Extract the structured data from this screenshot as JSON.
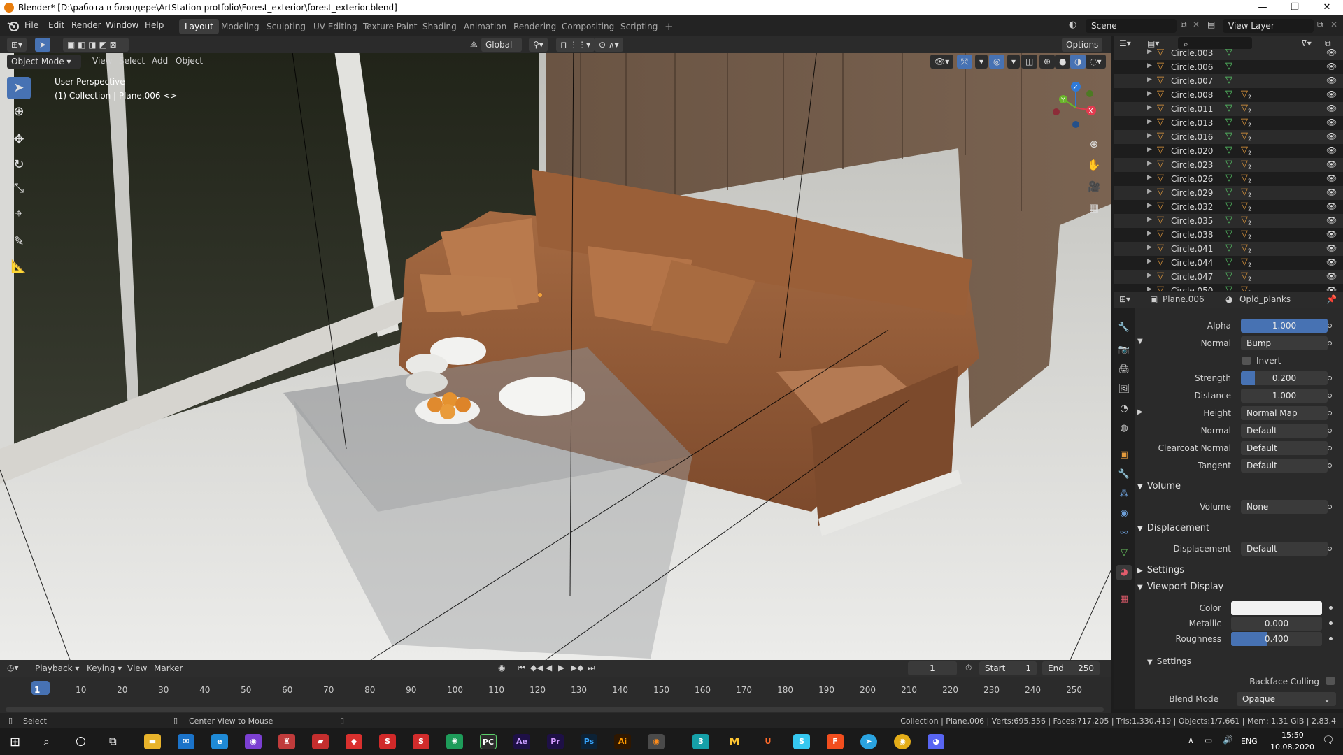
{
  "window": {
    "title": "Blender* [D:\\работа в блэндере\\ArtStation protfolio\\Forest_exterior\\forest_exterior.blend]",
    "minimize": "—",
    "maximize": "❐",
    "close": "✕"
  },
  "menu": [
    "File",
    "Edit",
    "Render",
    "Window",
    "Help"
  ],
  "workspaces": [
    "Layout",
    "Modeling",
    "Sculpting",
    "UV Editing",
    "Texture Paint",
    "Shading",
    "Animation",
    "Rendering",
    "Compositing",
    "Scripting"
  ],
  "add_workspace": "+",
  "scene": {
    "name": "Scene",
    "view_layer": "View Layer"
  },
  "viewport": {
    "mode": "Object Mode",
    "menus": [
      "View",
      "Select",
      "Add",
      "Object"
    ],
    "transform_orientation": "Global",
    "options": "Options",
    "overlay_text_1": "User Perspective",
    "overlay_text_2": "(1) Collection | Plane.006 <>",
    "gizmo_axes": {
      "z": "Z",
      "y": "Y",
      "x": "X"
    }
  },
  "outliner": {
    "rows": [
      "Circle.003",
      "Circle.006",
      "Circle.007",
      "Circle.008",
      "Circle.011",
      "Circle.013",
      "Circle.016",
      "Circle.020",
      "Circle.023",
      "Circle.026",
      "Circle.029",
      "Circle.032",
      "Circle.035",
      "Circle.038",
      "Circle.041",
      "Circle.044",
      "Circle.047",
      "Circle.050"
    ],
    "modifier_badge": "2"
  },
  "properties": {
    "object": "Plane.006",
    "material": "Opld_planks",
    "alpha_label": "Alpha",
    "alpha_value": "1.000",
    "normal_label": "Normal",
    "normal_value": "Bump",
    "invert_label": "Invert",
    "strength_label": "Strength",
    "strength_value": "0.200",
    "distance_label": "Distance",
    "distance_value": "1.000",
    "height_label": "Height",
    "height_value": "Normal Map",
    "normal2_label": "Normal",
    "normal2_value": "Default",
    "clearcoat_label": "Clearcoat Normal",
    "clearcoat_value": "Default",
    "tangent_label": "Tangent",
    "tangent_value": "Default",
    "volume_header": "Volume",
    "volume_label": "Volume",
    "volume_value": "None",
    "displacement_header": "Displacement",
    "displacement_label": "Displacement",
    "displacement_value": "Default",
    "settings_header": "Settings",
    "viewport_display_header": "Viewport Display",
    "color_label": "Color",
    "metallic_label": "Metallic",
    "metallic_value": "0.000",
    "roughness_label": "Roughness",
    "roughness_value": "0.400",
    "settings_sub_header": "Settings",
    "backface_label": "Backface Culling",
    "blend_mode_label": "Blend Mode",
    "blend_mode_value": "Opaque"
  },
  "timeline": {
    "menus": [
      "Playback",
      "Keying",
      "View",
      "Marker"
    ],
    "current_frame": "1",
    "start_label": "Start",
    "start_value": "1",
    "end_label": "End",
    "end_value": "250",
    "ruler": [
      "1",
      "10",
      "20",
      "30",
      "40",
      "50",
      "60",
      "70",
      "80",
      "90",
      "100",
      "110",
      "120",
      "130",
      "140",
      "150",
      "160",
      "170",
      "180",
      "190",
      "200",
      "210",
      "220",
      "230",
      "240",
      "250"
    ]
  },
  "status": {
    "left": "Select",
    "middle": "Center View to Mouse",
    "right": "Collection | Plane.006 | Verts:695,356 | Faces:717,205 | Tris:1,330,419 | Objects:1/7,661 | Mem: 1.31 GiB | 2.83.4"
  },
  "taskbar": {
    "lang": "ENG",
    "time": "15:50",
    "date": "10.08.2020"
  },
  "colors": {
    "accent": "#4772b3",
    "blender_orange": "#e87d0d"
  }
}
